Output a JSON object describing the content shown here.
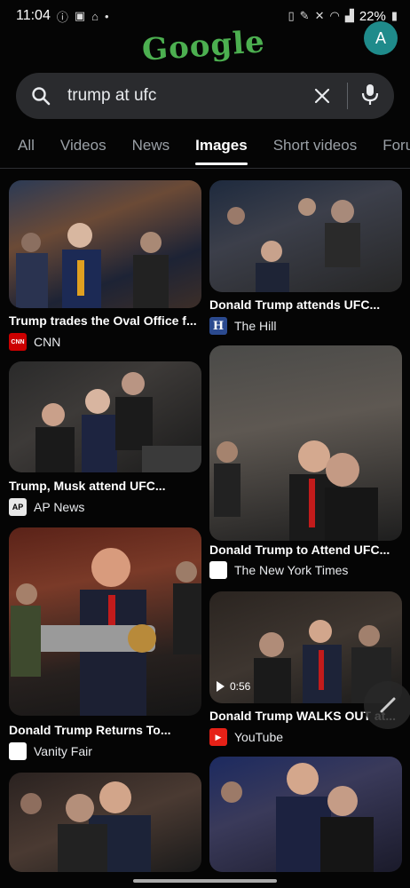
{
  "status": {
    "time": "11:04",
    "battery": "22%"
  },
  "logo": {
    "text": "Google"
  },
  "avatar": {
    "letter": "A"
  },
  "search": {
    "query": "trump at ufc"
  },
  "tabs": [
    "All",
    "Videos",
    "News",
    "Images",
    "Short videos",
    "Foru"
  ],
  "results": [
    {
      "caption": "Trump trades the Oval Office f...",
      "source": "CNN",
      "favicon": "CNN",
      "fav_color": "#cc0000"
    },
    {
      "caption": "Donald Trump attends UFC...",
      "source": "The Hill",
      "favicon": "H",
      "fav_color": "#2b4a8f"
    },
    {
      "caption": "Trump, Musk attend UFC...",
      "source": "AP News",
      "favicon": "AP",
      "fav_color": "#e8e8e8"
    },
    {
      "caption": "Donald Trump to Attend UFC...",
      "source": "The New York Times",
      "favicon": "",
      "fav_color": "#ffffff"
    },
    {
      "caption": "Donald Trump Returns To...",
      "source": "Vanity Fair",
      "favicon": "",
      "fav_color": "#ffffff"
    },
    {
      "caption": "Donald Trump WALKS OUT at...",
      "source": "YouTube",
      "favicon": "▶",
      "fav_color": "#e62117",
      "duration": "0:56"
    }
  ]
}
